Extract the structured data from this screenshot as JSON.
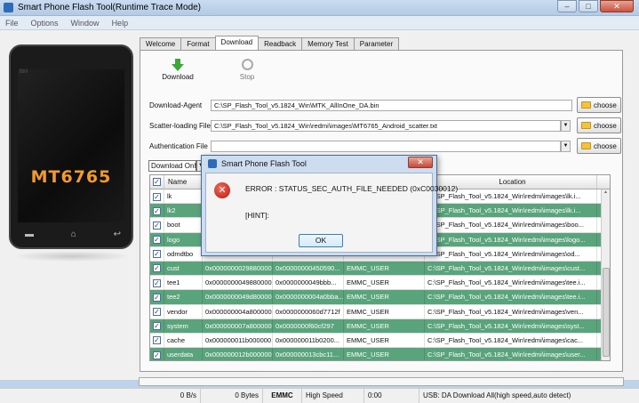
{
  "window": {
    "title": "Smart Phone Flash Tool(Runtime Trace Mode)",
    "min": "–",
    "max": "□",
    "close": "✕"
  },
  "menu": [
    "File",
    "Options",
    "Window",
    "Help"
  ],
  "phone": {
    "chip": "MT6765",
    "brand": "BM"
  },
  "tabs": [
    "Welcome",
    "Format",
    "Download",
    "Readback",
    "Memory Test",
    "Parameter"
  ],
  "active_tab": "Download",
  "toolbar": {
    "download": "Download",
    "stop": "Stop"
  },
  "form": {
    "download_agent_label": "Download-Agent",
    "download_agent_value": "C:\\SP_Flash_Tool_v5.1824_Win\\MTK_AllInOne_DA.bin",
    "scatter_label": "Scatter-loading File",
    "scatter_value": "C:\\SP_Flash_Tool_v5.1824_Win\\redmi\\images\\MT6765_Android_scatter.txt",
    "auth_label": "Authentication File",
    "auth_value": "",
    "choose": "choose",
    "mode": "Download Only"
  },
  "table": {
    "headers": [
      "",
      "Name",
      "",
      "",
      "",
      "Location"
    ],
    "rows": [
      {
        "name": "lk",
        "begin": "",
        "end": "",
        "region": "",
        "location": "C:\\SP_Flash_Tool_v5.1824_Win\\redmi\\images\\lk.i...",
        "style": "w"
      },
      {
        "name": "lk2",
        "begin": "",
        "end": "",
        "region": "",
        "location": "C:\\SP_Flash_Tool_v5.1824_Win\\redmi\\images\\lk.i...",
        "style": "g"
      },
      {
        "name": "boot",
        "begin": "",
        "end": "",
        "region": "",
        "location": "C:\\SP_Flash_Tool_v5.1824_Win\\redmi\\images\\boo...",
        "style": "w"
      },
      {
        "name": "logo",
        "begin": "",
        "end": "",
        "region": "",
        "location": "C:\\SP_Flash_Tool_v5.1824_Win\\redmi\\images\\logo...",
        "style": "g"
      },
      {
        "name": "odmdtbo",
        "begin": "",
        "end": "",
        "region": "",
        "location": "C:\\SP_Flash_Tool_v5.1824_Win\\redmi\\images\\od...",
        "style": "w"
      },
      {
        "name": "cust",
        "begin": "0x0000000029880000",
        "end": "0x00000000450590...",
        "region": "EMMC_USER",
        "location": "C:\\SP_Flash_Tool_v5.1824_Win\\redmi\\images\\cust...",
        "style": "g"
      },
      {
        "name": "tee1",
        "begin": "0x0000000049880000",
        "end": "0x0000000049bbb...",
        "region": "EMMC_USER",
        "location": "C:\\SP_Flash_Tool_v5.1824_Win\\redmi\\images\\tee.i...",
        "style": "w"
      },
      {
        "name": "tee2",
        "begin": "0x0000000049d80000",
        "end": "0x0000000004a0bba...",
        "region": "EMMC_USER",
        "location": "C:\\SP_Flash_Tool_v5.1824_Win\\redmi\\images\\tee.i...",
        "style": "g"
      },
      {
        "name": "vendor",
        "begin": "0x000000004a800000",
        "end": "0x0000000060d7712f",
        "region": "EMMC_USER",
        "location": "C:\\SP_Flash_Tool_v5.1824_Win\\redmi\\images\\ven...",
        "style": "w"
      },
      {
        "name": "system",
        "begin": "0x000000007a800000",
        "end": "0x0000000f60cf297",
        "region": "EMMC_USER",
        "location": "C:\\SP_Flash_Tool_v5.1824_Win\\redmi\\images\\syst...",
        "style": "g"
      },
      {
        "name": "cache",
        "begin": "0x000000011b000000",
        "end": "0x000000011b0200...",
        "region": "EMMC_USER",
        "location": "C:\\SP_Flash_Tool_v5.1824_Win\\redmi\\images\\cac...",
        "style": "w"
      },
      {
        "name": "userdata",
        "begin": "0x000000012b000000",
        "end": "0x000000013cbc11...",
        "region": "EMMC_USER",
        "location": "C:\\SP_Flash_Tool_v5.1824_Win\\redmi\\images\\user...",
        "style": "g"
      }
    ]
  },
  "status": {
    "speed": "0 B/s",
    "bytes": "0 Bytes",
    "storage": "EMMC",
    "mode": "High Speed",
    "time": "0:00",
    "usb": "USB: DA Download All(high speed,auto detect)"
  },
  "dialog": {
    "title": "Smart Phone Flash Tool",
    "close": "✕",
    "error": "ERROR : STATUS_SEC_AUTH_FILE_NEEDED (0xC0030012)",
    "hint": "[HINT]:",
    "ok": "OK"
  },
  "colors": {
    "row_green": "#5aa47c",
    "chip_orange": "#f29a2e",
    "error_red": "#c9241a"
  }
}
